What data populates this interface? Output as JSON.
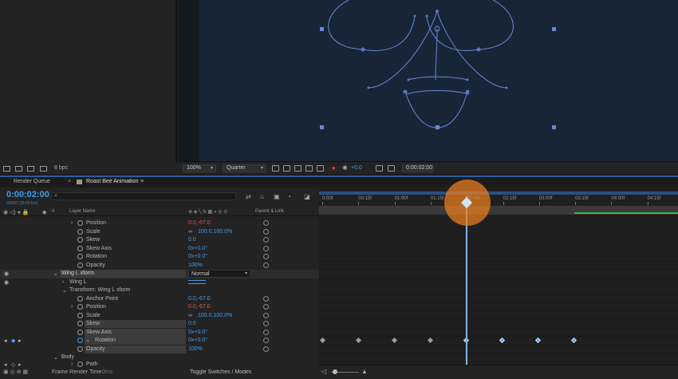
{
  "viewer": {
    "zoom": "100%",
    "resolution": "Quarter",
    "exposure": "+0.0",
    "timecode": "0:00:02:00",
    "bpc": "8 bpc"
  },
  "tabs": {
    "render_queue": "Render Queue",
    "comp_tab": "Roast Bee Animation",
    "menu": "≡"
  },
  "timeline": {
    "current_time": "0:00:02:00",
    "frame_info": "00060 (30.00 fps)",
    "search_placeholder": "",
    "col_num": "#",
    "col_layer": "Layer Name",
    "col_parent": "Parent & Link",
    "ruler": [
      "0:00f",
      "00:15f",
      "01:00f",
      "01:15f",
      "02:00f",
      "02:15f",
      "03:00f",
      "03:15f",
      "04:00f",
      "04:15f"
    ]
  },
  "layers": [
    {
      "label": "Position",
      "value": "0.0,-67.0",
      "color": "red"
    },
    {
      "label": "Scale",
      "value": "100.0,100.0%",
      "color": "blue",
      "link": true
    },
    {
      "label": "Skew",
      "value": "0.0",
      "color": "blue"
    },
    {
      "label": "Skew Axis",
      "value": "0x+0.0°",
      "color": "blue"
    },
    {
      "label": "Rotation",
      "value": "0x+0.0°",
      "color": "blue"
    },
    {
      "label": "Opacity",
      "value": "100%",
      "color": "blue"
    },
    {
      "label": "Wing L xform",
      "mode": "Normal"
    },
    {
      "label": "Wing L"
    },
    {
      "label": "Transform: Wing L xform"
    },
    {
      "label": "Anchor Point",
      "value": "0.0,-67.0",
      "color": "blue"
    },
    {
      "label": "Position",
      "value": "0.0,-67.0",
      "color": "red"
    },
    {
      "label": "Scale",
      "value": "100.0,100.0%",
      "color": "blue",
      "link": true
    },
    {
      "label": "Skew",
      "value": "0.0",
      "color": "blue"
    },
    {
      "label": "Skew Axis",
      "value": "0x+0.0°",
      "color": "blue"
    },
    {
      "label": "Rotation",
      "value": "0x+0.0°",
      "color": "blue"
    },
    {
      "label": "Opacity",
      "value": "100%",
      "color": "blue"
    },
    {
      "label": "Body"
    },
    {
      "label": "Path"
    }
  ],
  "bottom": {
    "frame_render": "Frame Render Time",
    "frame_render_value": "0ms",
    "toggle": "Toggle Switches / Modes"
  }
}
